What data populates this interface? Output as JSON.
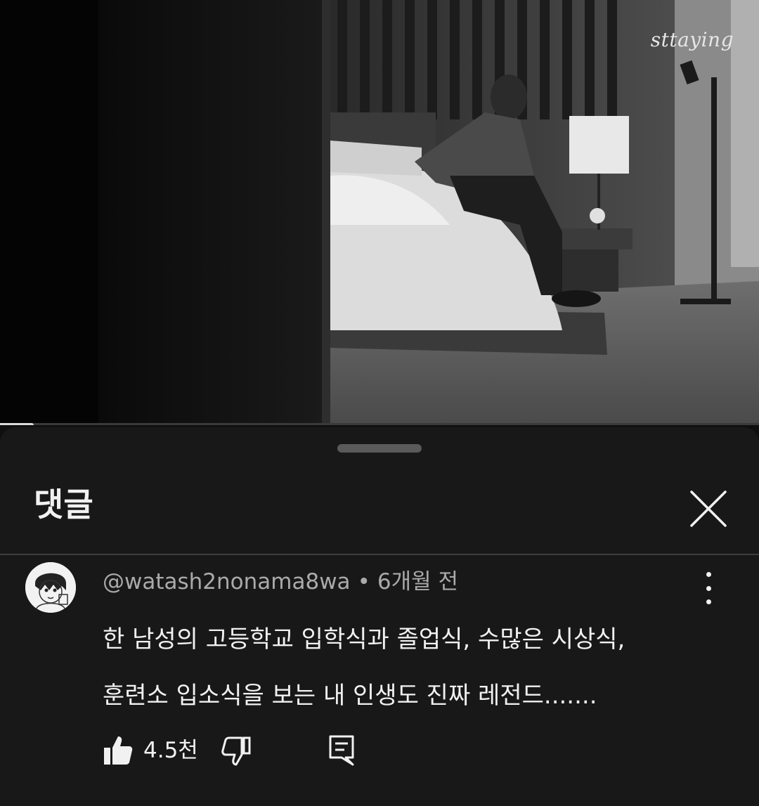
{
  "video": {
    "watermark": "sttaying",
    "progress_fraction": 0.044
  },
  "comments_panel": {
    "title": "댓글",
    "close_icon": "close-icon"
  },
  "comment": {
    "author": "@watash2nonama8wa",
    "separator": "•",
    "time": "6개월 전",
    "text_lines": [
      "한 남성의 고등학교 입학식과 졸업식, 수많은 시상식,",
      "훈련소 입소식을 보는 내 인생도 진짜 레전드......."
    ],
    "likes": "4.5천",
    "icons": {
      "like": "thumbs-up-icon",
      "dislike": "thumbs-down-icon",
      "reply": "reply-icon",
      "more": "more-vertical-icon"
    }
  },
  "colors": {
    "background": "#0f0f0f",
    "sheet": "#181818",
    "text_primary": "#f1f1f1",
    "text_secondary": "#aaaaaa"
  }
}
